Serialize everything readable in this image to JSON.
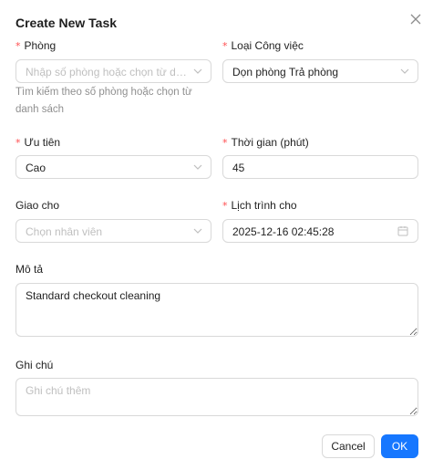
{
  "modal": {
    "title": "Create New Task"
  },
  "form": {
    "room": {
      "label": "Phòng",
      "placeholder": "Nhập số phòng hoặc chọn từ danh sách",
      "help": "Tìm kiếm theo số phòng hoặc chọn từ danh sách"
    },
    "task_type": {
      "label": "Loại Công việc",
      "value": "Dọn phòng Trả phòng"
    },
    "priority": {
      "label": "Ưu tiên",
      "value": "Cao"
    },
    "duration": {
      "label": "Thời gian (phút)",
      "value": "45"
    },
    "assignee": {
      "label": "Giao cho",
      "placeholder": "Chọn nhân viên"
    },
    "schedule": {
      "label": "Lịch trình cho",
      "value": "2025-12-16 02:45:28"
    },
    "description": {
      "label": "Mô tả",
      "value": "Standard checkout cleaning"
    },
    "notes": {
      "label": "Ghi chú",
      "placeholder": "Ghi chú thêm"
    }
  },
  "footer": {
    "cancel_label": "Cancel",
    "ok_label": "OK"
  },
  "colors": {
    "primary": "#1677ff",
    "required": "#ff4d4f",
    "border": "#d9d9d9",
    "placeholder": "#bfbfbf"
  },
  "icons": [
    "close-icon",
    "chevron-down-icon",
    "calendar-icon",
    "resize-handle-icon"
  ]
}
